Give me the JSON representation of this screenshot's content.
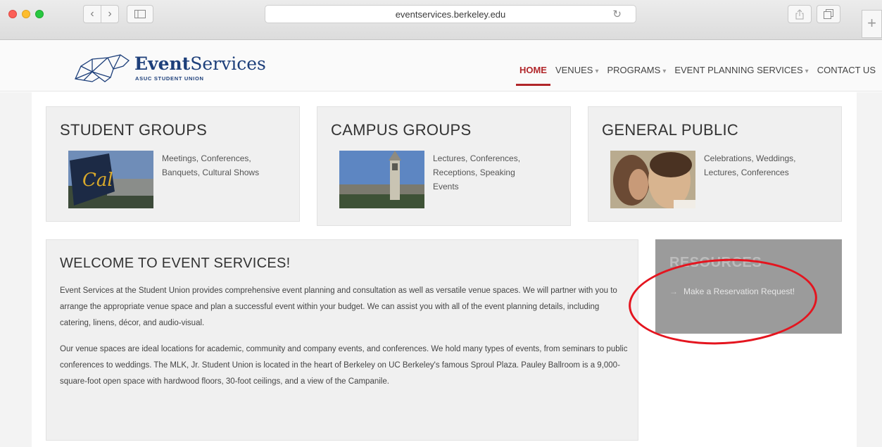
{
  "browser": {
    "url": "eventservices.berkeley.edu",
    "icons": [
      "back-icon",
      "forward-icon",
      "sidebar-icon",
      "reload-icon",
      "share-icon",
      "tabs-icon",
      "new-tab-icon"
    ]
  },
  "header": {
    "logo": {
      "word_bold": "Event",
      "word_light": "Services",
      "subtitle": "ASUC STUDENT UNION"
    },
    "nav": [
      {
        "label": "HOME",
        "active": true,
        "dropdown": false
      },
      {
        "label": "VENUES",
        "active": false,
        "dropdown": true
      },
      {
        "label": "PROGRAMS",
        "active": false,
        "dropdown": true
      },
      {
        "label": "EVENT PLANNING SERVICES",
        "active": false,
        "dropdown": true
      },
      {
        "label": "CONTACT US",
        "active": false,
        "dropdown": false
      }
    ],
    "accent_color": "#b1262a"
  },
  "cards": [
    {
      "title": "STUDENT GROUPS",
      "text": "Meetings, Conferences, Banquets, Cultural Shows",
      "image": "cal-flag-photo"
    },
    {
      "title": "CAMPUS GROUPS",
      "text": "Lectures, Conferences, Receptions, Speaking Events",
      "image": "campanile-photo"
    },
    {
      "title": "GENERAL PUBLIC",
      "text": "Celebrations, Weddings, Lectures, Conferences",
      "image": "wedding-couple-photo"
    }
  ],
  "welcome": {
    "title": "WELCOME TO EVENT SERVICES!",
    "p1": "Event Services at the Student Union provides comprehensive event planning and consultation as well as versatile venue spaces. We will partner with you to arrange the appropriate venue space and plan a successful event within your budget. We can assist you with all of the event planning details, including catering, linens, décor, and audio-visual.",
    "p2": "Our venue spaces are ideal locations for academic, community and company events, and conferences. We hold many types of events, from seminars to public conferences to weddings. The MLK, Jr. Student Union is located in the heart of Berkeley on UC Berkeley's famous Sproul Plaza. Pauley Ballroom is a 9,000-square-foot open space with hardwood floors, 30-foot ceilings, and a view of the Campanile."
  },
  "resources": {
    "title": "RESOURCES",
    "link": "Make a Reservation Request!"
  },
  "annotation": {
    "color": "#e4151f"
  }
}
